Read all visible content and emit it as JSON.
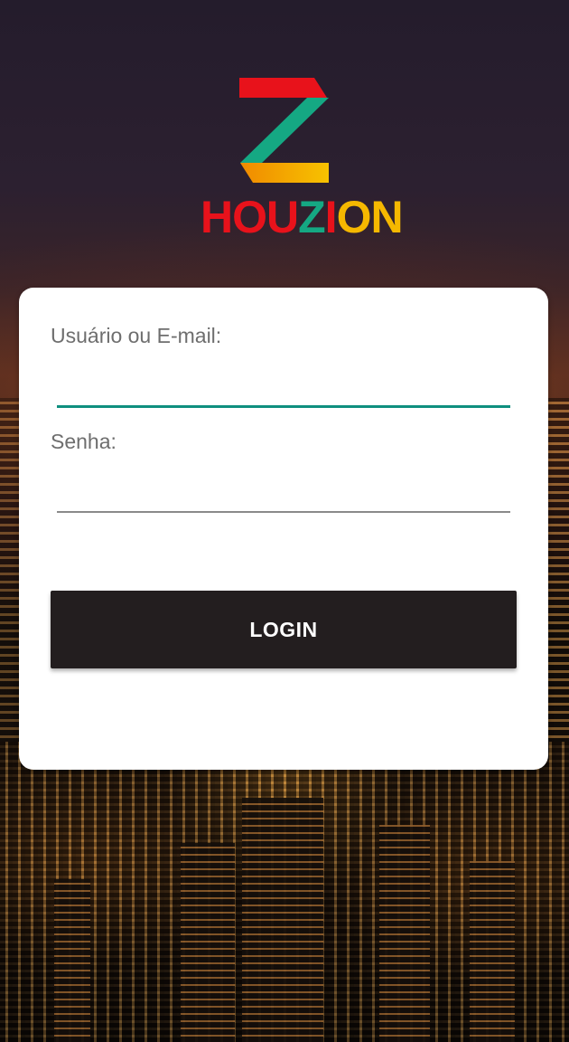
{
  "app": {
    "brand": {
      "wordmark_parts": [
        "HOU",
        "Z",
        "I",
        "ON"
      ]
    }
  },
  "login": {
    "username_label": "Usuário ou E-mail:",
    "username_value": "",
    "password_label": "Senha:",
    "password_value": "",
    "submit_label": "LOGIN"
  },
  "theme": {
    "button_color": "#231e1f",
    "focus_underline_color": "#0e8f7f",
    "logo_red": "#e8121b",
    "logo_teal": "#15a883",
    "logo_yellow": "#f5b800"
  },
  "background": {
    "image": "night-city-skyline"
  }
}
